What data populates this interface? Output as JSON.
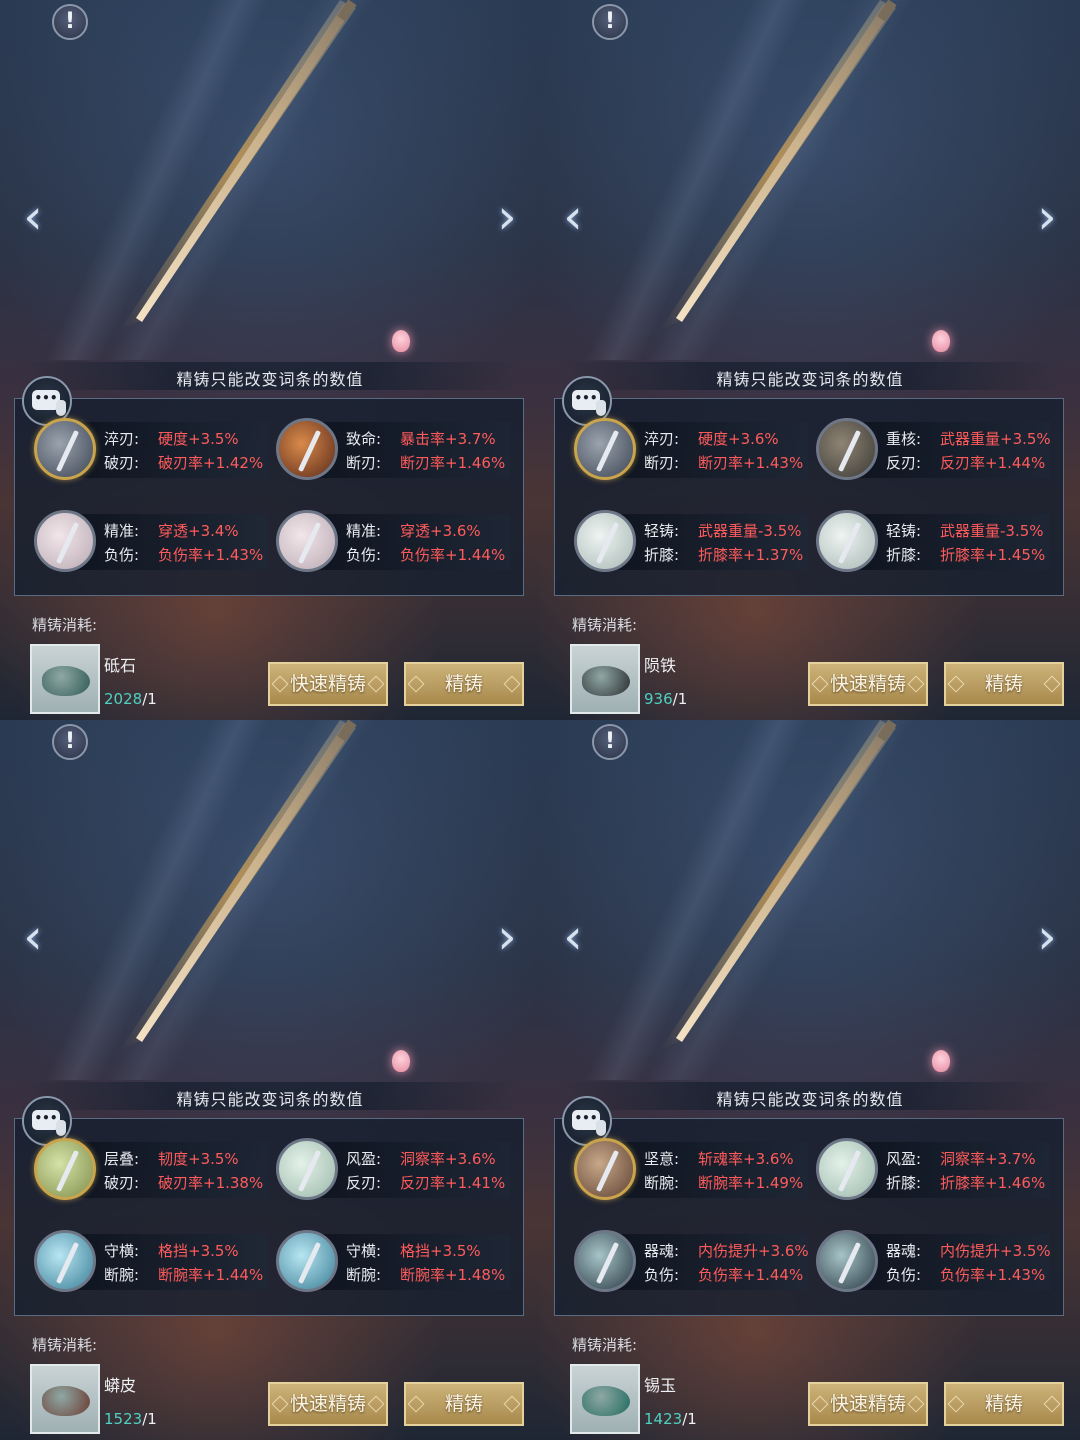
{
  "panels": [
    {
      "hint": "精铸只能改变词条的数值",
      "warn": "!",
      "nav_prev": "‹",
      "nav_next": "›",
      "chat_icon": "chat-bubble-icon",
      "attributes": [
        {
          "icon": "blade-orb-icon",
          "frame": "gold",
          "lines": [
            {
              "label": "淬刃:",
              "value": "硬度+3.5%"
            },
            {
              "label": "破刃:",
              "value": "破刃率+1.42%"
            }
          ]
        },
        {
          "icon": "fire-orb-icon",
          "frame": "plain",
          "lines": [
            {
              "label": "致命:",
              "value": "暴击率+3.7%"
            },
            {
              "label": "断刃:",
              "value": "断刃率+1.46%"
            }
          ]
        },
        {
          "icon": "blossom-orb-icon",
          "frame": "plain",
          "lines": [
            {
              "label": "精准:",
              "value": "穿透+3.4%"
            },
            {
              "label": "负伤:",
              "value": "负伤率+1.43%"
            }
          ]
        },
        {
          "icon": "blossom-orb-icon",
          "frame": "plain",
          "lines": [
            {
              "label": "精准:",
              "value": "穿透+3.6%"
            },
            {
              "label": "负伤:",
              "value": "负伤率+1.44%"
            }
          ]
        }
      ],
      "cost_title": "精铸消耗:",
      "item": {
        "name": "砥石",
        "have": "2028",
        "need": "/1",
        "icon": "whetstone-icon",
        "color": "#2f5a52"
      },
      "buttons": {
        "quick": "快速精铸",
        "refine": "精铸"
      }
    },
    {
      "hint": "精铸只能改变词条的数值",
      "warn": "!",
      "nav_prev": "‹",
      "nav_next": "›",
      "chat_icon": "chat-bubble-icon",
      "attributes": [
        {
          "icon": "blade-orb-icon",
          "frame": "gold",
          "lines": [
            {
              "label": "淬刃:",
              "value": "硬度+3.6%"
            },
            {
              "label": "断刃:",
              "value": "断刃率+1.43%"
            }
          ]
        },
        {
          "icon": "pillar-orb-icon",
          "frame": "plain",
          "lines": [
            {
              "label": "重核:",
              "value": "武器重量+3.5%"
            },
            {
              "label": "反刃:",
              "value": "反刃率+1.44%"
            }
          ]
        },
        {
          "icon": "feather-orb-icon",
          "frame": "plain",
          "lines": [
            {
              "label": "轻铸:",
              "value": "武器重量-3.5%"
            },
            {
              "label": "折膝:",
              "value": "折膝率+1.37%"
            }
          ]
        },
        {
          "icon": "feather-orb-icon",
          "frame": "plain",
          "lines": [
            {
              "label": "轻铸:",
              "value": "武器重量-3.5%"
            },
            {
              "label": "折膝:",
              "value": "折膝率+1.45%"
            }
          ]
        }
      ],
      "cost_title": "精铸消耗:",
      "item": {
        "name": "陨铁",
        "have": "936",
        "need": "/1",
        "icon": "meteor-iron-icon",
        "color": "#2a2c30"
      },
      "buttons": {
        "quick": "快速精铸",
        "refine": "精铸"
      }
    },
    {
      "hint": "精铸只能改变词条的数值",
      "warn": "!",
      "nav_prev": "‹",
      "nav_next": "›",
      "chat_icon": "chat-bubble-icon",
      "attributes": [
        {
          "icon": "leaf-orb-icon",
          "frame": "gold",
          "lines": [
            {
              "label": "层叠:",
              "value": "韧度+3.5%"
            },
            {
              "label": "破刃:",
              "value": "破刃率+1.38%"
            }
          ]
        },
        {
          "icon": "wind-orb-icon",
          "frame": "plain",
          "lines": [
            {
              "label": "风盈:",
              "value": "洞察率+3.6%"
            },
            {
              "label": "反刃:",
              "value": "反刃率+1.41%"
            }
          ]
        },
        {
          "icon": "ice-orb-icon",
          "frame": "plain",
          "lines": [
            {
              "label": "守横:",
              "value": "格挡+3.5%"
            },
            {
              "label": "断腕:",
              "value": "断腕率+1.44%"
            }
          ]
        },
        {
          "icon": "ice-orb-icon",
          "frame": "plain",
          "lines": [
            {
              "label": "守横:",
              "value": "格挡+3.5%"
            },
            {
              "label": "断腕:",
              "value": "断腕率+1.48%"
            }
          ]
        }
      ],
      "cost_title": "精铸消耗:",
      "item": {
        "name": "蟒皮",
        "have": "1523",
        "need": "/1",
        "icon": "python-skin-icon",
        "color": "#6a3a30"
      },
      "buttons": {
        "quick": "快速精铸",
        "refine": "精铸"
      }
    },
    {
      "hint": "精铸只能改变词条的数值",
      "warn": "!",
      "nav_prev": "‹",
      "nav_next": "›",
      "chat_icon": "chat-bubble-icon",
      "attributes": [
        {
          "icon": "wood-orb-icon",
          "frame": "gold",
          "lines": [
            {
              "label": "坚意:",
              "value": "斩魂率+3.6%"
            },
            {
              "label": "断腕:",
              "value": "断腕率+1.49%"
            }
          ]
        },
        {
          "icon": "wind-orb-icon",
          "frame": "plain",
          "lines": [
            {
              "label": "风盈:",
              "value": "洞察率+3.7%"
            },
            {
              "label": "折膝:",
              "value": "折膝率+1.46%"
            }
          ]
        },
        {
          "icon": "spirit-orb-icon",
          "frame": "plain",
          "lines": [
            {
              "label": "器魂:",
              "value": "内伤提升+3.6%"
            },
            {
              "label": "负伤:",
              "value": "负伤率+1.44%"
            }
          ]
        },
        {
          "icon": "spirit-orb-icon",
          "frame": "plain",
          "lines": [
            {
              "label": "器魂:",
              "value": "内伤提升+3.5%"
            },
            {
              "label": "负伤:",
              "value": "负伤率+1.43%"
            }
          ]
        }
      ],
      "cost_title": "精铸消耗:",
      "item": {
        "name": "锡玉",
        "have": "1423",
        "need": "/1",
        "icon": "tin-jade-icon",
        "color": "#1f6a5e"
      },
      "buttons": {
        "quick": "快速精铸",
        "refine": "精铸"
      }
    }
  ]
}
